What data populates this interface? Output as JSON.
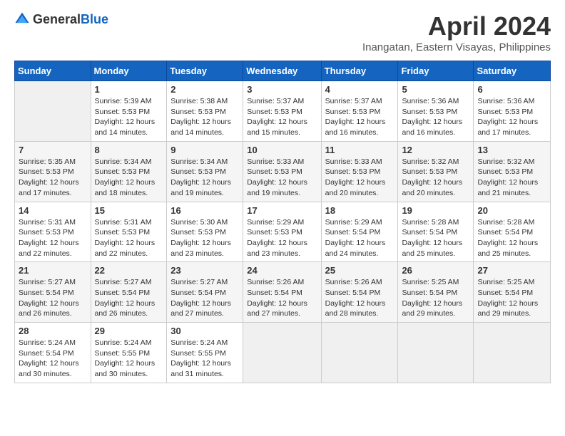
{
  "header": {
    "logo_general": "General",
    "logo_blue": "Blue",
    "month_title": "April 2024",
    "location": "Inangatan, Eastern Visayas, Philippines"
  },
  "calendar": {
    "days_of_week": [
      "Sunday",
      "Monday",
      "Tuesday",
      "Wednesday",
      "Thursday",
      "Friday",
      "Saturday"
    ],
    "weeks": [
      [
        {
          "day": "",
          "info": ""
        },
        {
          "day": "1",
          "info": "Sunrise: 5:39 AM\nSunset: 5:53 PM\nDaylight: 12 hours\nand 14 minutes."
        },
        {
          "day": "2",
          "info": "Sunrise: 5:38 AM\nSunset: 5:53 PM\nDaylight: 12 hours\nand 14 minutes."
        },
        {
          "day": "3",
          "info": "Sunrise: 5:37 AM\nSunset: 5:53 PM\nDaylight: 12 hours\nand 15 minutes."
        },
        {
          "day": "4",
          "info": "Sunrise: 5:37 AM\nSunset: 5:53 PM\nDaylight: 12 hours\nand 16 minutes."
        },
        {
          "day": "5",
          "info": "Sunrise: 5:36 AM\nSunset: 5:53 PM\nDaylight: 12 hours\nand 16 minutes."
        },
        {
          "day": "6",
          "info": "Sunrise: 5:36 AM\nSunset: 5:53 PM\nDaylight: 12 hours\nand 17 minutes."
        }
      ],
      [
        {
          "day": "7",
          "info": "Sunrise: 5:35 AM\nSunset: 5:53 PM\nDaylight: 12 hours\nand 17 minutes."
        },
        {
          "day": "8",
          "info": "Sunrise: 5:34 AM\nSunset: 5:53 PM\nDaylight: 12 hours\nand 18 minutes."
        },
        {
          "day": "9",
          "info": "Sunrise: 5:34 AM\nSunset: 5:53 PM\nDaylight: 12 hours\nand 19 minutes."
        },
        {
          "day": "10",
          "info": "Sunrise: 5:33 AM\nSunset: 5:53 PM\nDaylight: 12 hours\nand 19 minutes."
        },
        {
          "day": "11",
          "info": "Sunrise: 5:33 AM\nSunset: 5:53 PM\nDaylight: 12 hours\nand 20 minutes."
        },
        {
          "day": "12",
          "info": "Sunrise: 5:32 AM\nSunset: 5:53 PM\nDaylight: 12 hours\nand 20 minutes."
        },
        {
          "day": "13",
          "info": "Sunrise: 5:32 AM\nSunset: 5:53 PM\nDaylight: 12 hours\nand 21 minutes."
        }
      ],
      [
        {
          "day": "14",
          "info": "Sunrise: 5:31 AM\nSunset: 5:53 PM\nDaylight: 12 hours\nand 22 minutes."
        },
        {
          "day": "15",
          "info": "Sunrise: 5:31 AM\nSunset: 5:53 PM\nDaylight: 12 hours\nand 22 minutes."
        },
        {
          "day": "16",
          "info": "Sunrise: 5:30 AM\nSunset: 5:53 PM\nDaylight: 12 hours\nand 23 minutes."
        },
        {
          "day": "17",
          "info": "Sunrise: 5:29 AM\nSunset: 5:53 PM\nDaylight: 12 hours\nand 23 minutes."
        },
        {
          "day": "18",
          "info": "Sunrise: 5:29 AM\nSunset: 5:54 PM\nDaylight: 12 hours\nand 24 minutes."
        },
        {
          "day": "19",
          "info": "Sunrise: 5:28 AM\nSunset: 5:54 PM\nDaylight: 12 hours\nand 25 minutes."
        },
        {
          "day": "20",
          "info": "Sunrise: 5:28 AM\nSunset: 5:54 PM\nDaylight: 12 hours\nand 25 minutes."
        }
      ],
      [
        {
          "day": "21",
          "info": "Sunrise: 5:27 AM\nSunset: 5:54 PM\nDaylight: 12 hours\nand 26 minutes."
        },
        {
          "day": "22",
          "info": "Sunrise: 5:27 AM\nSunset: 5:54 PM\nDaylight: 12 hours\nand 26 minutes."
        },
        {
          "day": "23",
          "info": "Sunrise: 5:27 AM\nSunset: 5:54 PM\nDaylight: 12 hours\nand 27 minutes."
        },
        {
          "day": "24",
          "info": "Sunrise: 5:26 AM\nSunset: 5:54 PM\nDaylight: 12 hours\nand 27 minutes."
        },
        {
          "day": "25",
          "info": "Sunrise: 5:26 AM\nSunset: 5:54 PM\nDaylight: 12 hours\nand 28 minutes."
        },
        {
          "day": "26",
          "info": "Sunrise: 5:25 AM\nSunset: 5:54 PM\nDaylight: 12 hours\nand 29 minutes."
        },
        {
          "day": "27",
          "info": "Sunrise: 5:25 AM\nSunset: 5:54 PM\nDaylight: 12 hours\nand 29 minutes."
        }
      ],
      [
        {
          "day": "28",
          "info": "Sunrise: 5:24 AM\nSunset: 5:54 PM\nDaylight: 12 hours\nand 30 minutes."
        },
        {
          "day": "29",
          "info": "Sunrise: 5:24 AM\nSunset: 5:55 PM\nDaylight: 12 hours\nand 30 minutes."
        },
        {
          "day": "30",
          "info": "Sunrise: 5:24 AM\nSunset: 5:55 PM\nDaylight: 12 hours\nand 31 minutes."
        },
        {
          "day": "",
          "info": ""
        },
        {
          "day": "",
          "info": ""
        },
        {
          "day": "",
          "info": ""
        },
        {
          "day": "",
          "info": ""
        }
      ]
    ]
  }
}
